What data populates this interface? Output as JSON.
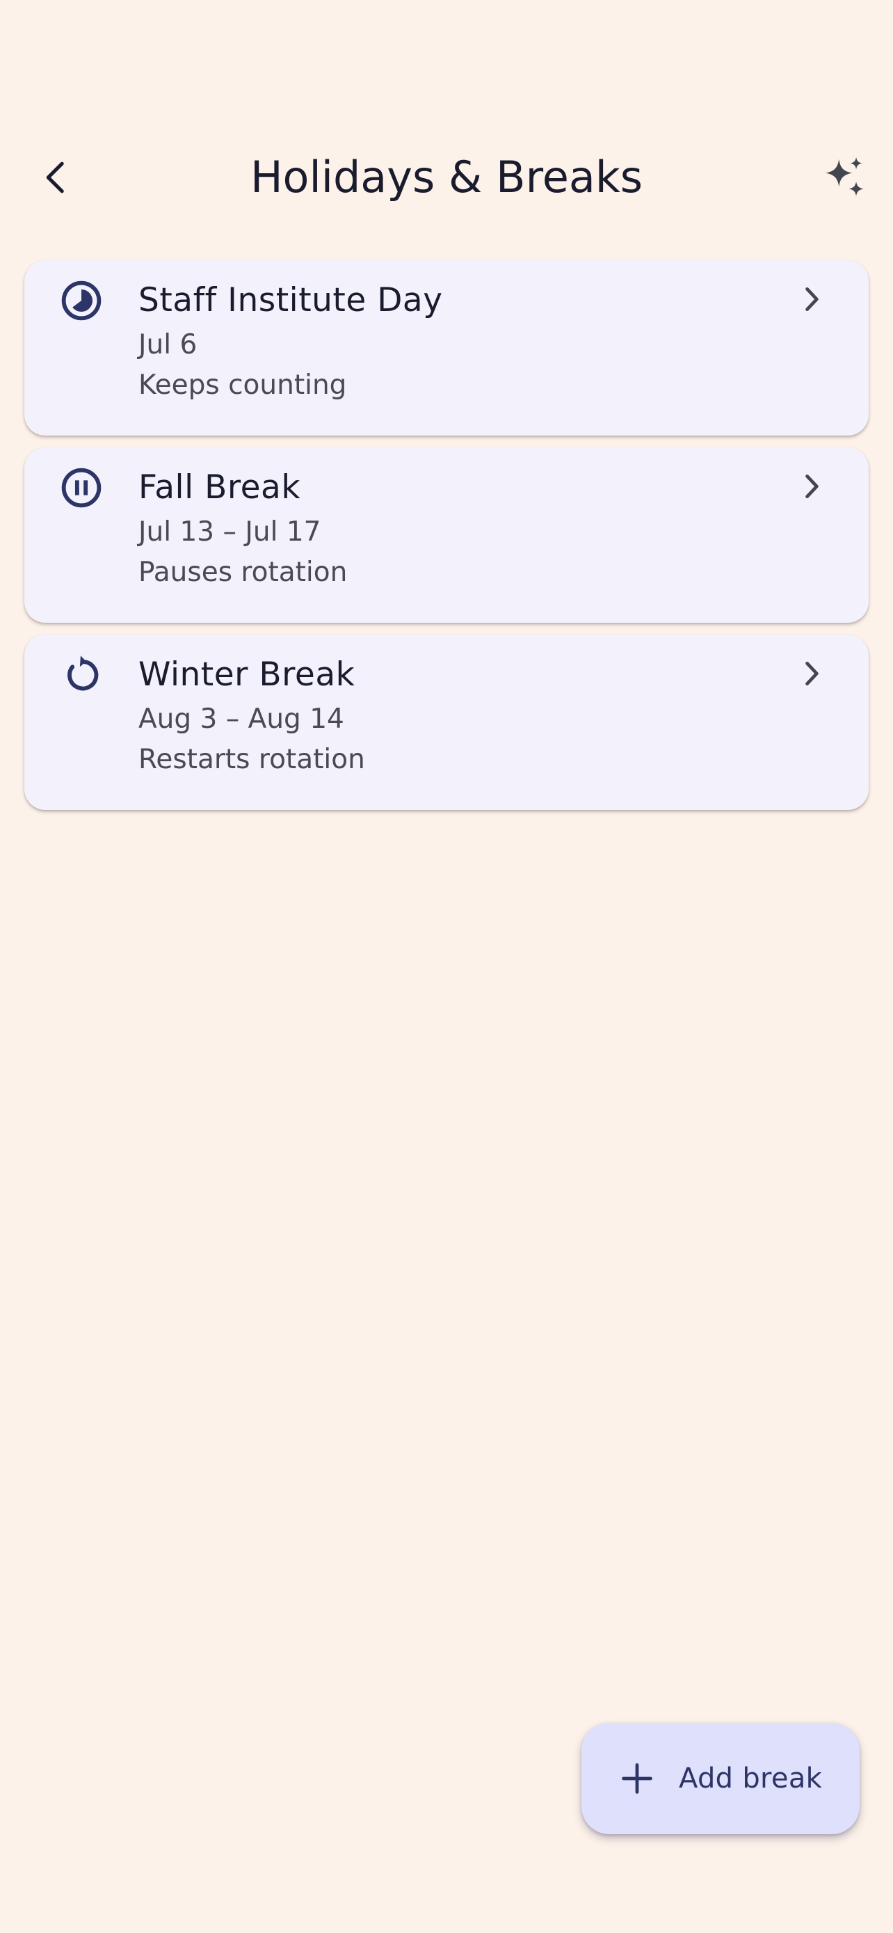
{
  "header": {
    "title": "Holidays & Breaks",
    "back_icon": "arrow-back-icon",
    "sparkle_icon": "sparkle-icon"
  },
  "breaks": [
    {
      "title": "Staff Institute Day",
      "dates": "Jul 6",
      "rule": "Keeps counting",
      "icon": "timelapse-icon"
    },
    {
      "title": "Fall Break",
      "dates": "Jul 13 – Jul 17",
      "rule": "Pauses rotation",
      "icon": "pause-circle-icon"
    },
    {
      "title": "Winter Break",
      "dates": "Aug 3 – Aug 14",
      "rule": "Restarts rotation",
      "icon": "restart-icon"
    }
  ],
  "fab": {
    "label": "Add break",
    "icon": "plus-icon"
  },
  "colors": {
    "background": "#FCF2EA",
    "card": "#F3F2FC",
    "accent_icon": "#2C3566",
    "fab": "#DFE0FB"
  }
}
